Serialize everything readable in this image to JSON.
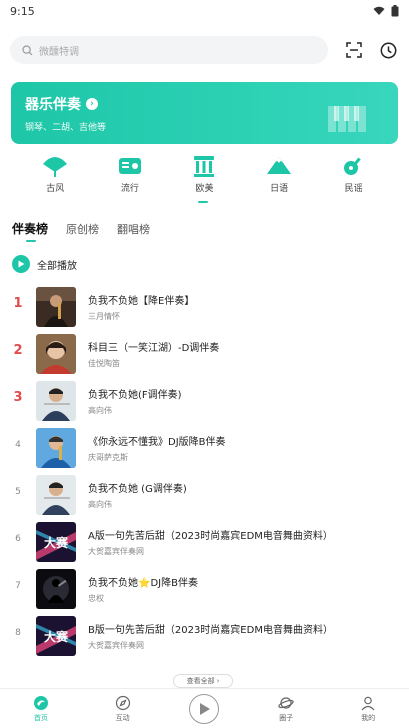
{
  "status": {
    "time": "9:15"
  },
  "search": {
    "placeholder": "微醺特调"
  },
  "banner": {
    "title": "器乐伴奏",
    "subtitle": "钢琴、二胡、吉他等"
  },
  "genres": [
    {
      "label": "古风",
      "icon": "fan-icon"
    },
    {
      "label": "流行",
      "icon": "radio-icon"
    },
    {
      "label": "欧美",
      "icon": "temple-icon"
    },
    {
      "label": "日语",
      "icon": "mountain-icon"
    },
    {
      "label": "民谣",
      "icon": "guitar-icon"
    }
  ],
  "tabs": [
    "伴奏榜",
    "原创榜",
    "翻唱榜"
  ],
  "play_all": "全部播放",
  "songs": [
    {
      "rank": "1",
      "title": "负我不负她【降E伴奏】",
      "artist": "三月情怀"
    },
    {
      "rank": "2",
      "title": "科目三（一笑江湖）-D调伴奏",
      "artist": "佳悦陶笛"
    },
    {
      "rank": "3",
      "title": "负我不负她(F调伴奏)",
      "artist": "高向伟"
    },
    {
      "rank": "4",
      "title": "《你永远不懂我》DJ版降B伴奏",
      "artist": "庆哥萨克斯"
    },
    {
      "rank": "5",
      "title": "负我不负她 (G调伴奏)",
      "artist": "高向伟"
    },
    {
      "rank": "6",
      "title": "A版一句先苦后甜（2023时尚嘉宾EDM电音舞曲资料）",
      "artist": "大贺嘉宾伴奏网"
    },
    {
      "rank": "7",
      "title": "负我不负她⭐DJ降B伴奏",
      "artist": "忠权"
    },
    {
      "rank": "8",
      "title": "B版一句先苦后甜（2023时尚嘉宾EDM电音舞曲资料）",
      "artist": "大贺嘉宾伴奏网"
    }
  ],
  "see_all": "查看全部",
  "nav": [
    {
      "label": "首页",
      "icon": "home-icon"
    },
    {
      "label": "互动",
      "icon": "compass-icon"
    },
    {
      "label": "",
      "icon": "play-icon"
    },
    {
      "label": "圈子",
      "icon": "planet-icon"
    },
    {
      "label": "我的",
      "icon": "profile-icon"
    }
  ],
  "colors": {
    "accent": "#1ec6a8",
    "rank_top": "#e24b4b"
  }
}
